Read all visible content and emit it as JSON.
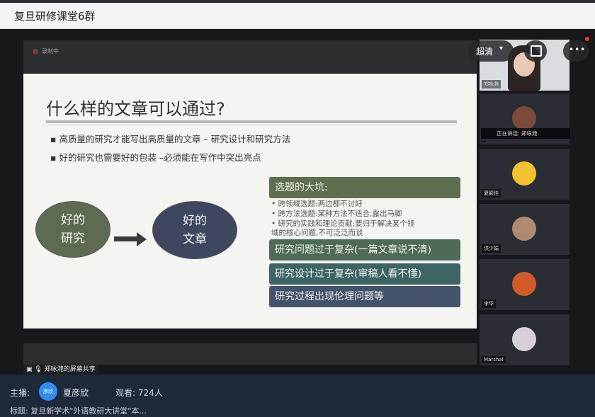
{
  "window": {
    "title": "复旦研修课堂6群"
  },
  "recording": {
    "label": "录制中"
  },
  "slide": {
    "heading": "什么样的文章可以通过?",
    "bullets": [
      "▪ 高质量的研究才能写出高质量的文章 – 研究设计和研究方法",
      "▪ 好的研究也需要好的包装 –必须能在写作中突出亮点"
    ],
    "oval_left": [
      "好的",
      "研究"
    ],
    "oval_right": [
      "好的",
      "文章"
    ],
    "box1": "选题的大坑:",
    "sub_items": [
      "• 跨领域选题:两边都不讨好",
      "• 跨方法选题:某种方法不适合,露出马脚",
      "• 研究的实践和理论贡献:要归于解决某个领",
      "  域的核心问题,不可泛泛而谈"
    ],
    "box2": "研究问题过于复杂(一篇文章说不清)",
    "box3": "研究设计过于复杂(审稿人看不懂)",
    "box4": "研究过程出现伦理问题等"
  },
  "controls": {
    "quality": "超清",
    "quality_icon": "chevron-down-icon",
    "popout_icon": "popout-icon",
    "more": "•••"
  },
  "participants": [
    {
      "name": "郑咏滟"
    },
    {
      "name": ""
    },
    {
      "name": "夏颖佳"
    },
    {
      "name": "洪少娟"
    },
    {
      "name": "李华"
    },
    {
      "name": "Marshal"
    }
  ],
  "speaking": {
    "text": "正在讲话: 郑咏滟"
  },
  "share_label": {
    "text": "郑咏滟的屏幕共享"
  },
  "footer": {
    "host_label": "主播:",
    "host_avatar": "彦欣",
    "host_name": "夏彦欣",
    "viewers": "观看: 724人",
    "topic": "标题: 复旦新学术\"外语教研大讲堂\"本..."
  }
}
